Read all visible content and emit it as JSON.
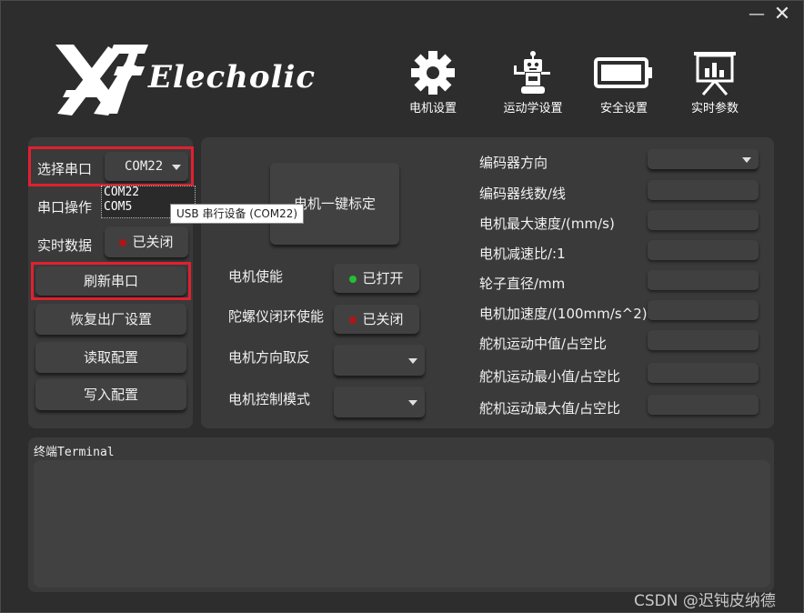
{
  "window": {
    "minimize_glyph": "—",
    "close_glyph": "✕"
  },
  "brand": {
    "name": "Elecholic"
  },
  "topnav": [
    {
      "label": "电机设置",
      "icon": "gear-icon"
    },
    {
      "label": "运动学设置",
      "icon": "robot-icon"
    },
    {
      "label": "安全设置",
      "icon": "battery-icon"
    },
    {
      "label": "实时参数",
      "icon": "presentation-chart-icon"
    }
  ],
  "left": {
    "port_label": "选择串口",
    "port_value": "COM22",
    "port_options": [
      "COM22",
      "COM5"
    ],
    "tooltip": "USB 串行设备 (COM22)",
    "port_op_label": "串口操作",
    "realtime_label": "实时数据",
    "realtime_state": "已关闭",
    "refresh": "刷新串口",
    "restore": "恢复出厂设置",
    "read": "读取配置",
    "write": "写入配置"
  },
  "middle": {
    "calibrate": "电机一键标定",
    "motor_enable_label": "电机使能",
    "motor_enable_state": "已打开",
    "gyro_label": "陀螺仪闭环使能",
    "gyro_state": "已关闭",
    "direction_label": "电机方向取反",
    "mode_label": "电机控制模式"
  },
  "params": [
    {
      "label": "编码器方向",
      "kind": "combo"
    },
    {
      "label": "编码器线数/线",
      "kind": "field"
    },
    {
      "label": "电机最大速度/(mm/s)",
      "kind": "field"
    },
    {
      "label": "电机减速比/:1",
      "kind": "field"
    },
    {
      "label": "轮子直径/mm",
      "kind": "field"
    },
    {
      "label": "电机加速度/(100mm/s^2)",
      "kind": "field"
    },
    {
      "label": "舵机运动中值/占空比",
      "kind": "field"
    },
    {
      "label": "舵机运动最小值/占空比",
      "kind": "field"
    },
    {
      "label": "舵机运动最大值/占空比",
      "kind": "field"
    }
  ],
  "terminal": {
    "title": "终端Terminal"
  },
  "watermark": "CSDN @迟钝皮纳德",
  "colors": {
    "highlight_red": "#e02030",
    "on_green": "#22c033",
    "off_red": "#b01515"
  }
}
